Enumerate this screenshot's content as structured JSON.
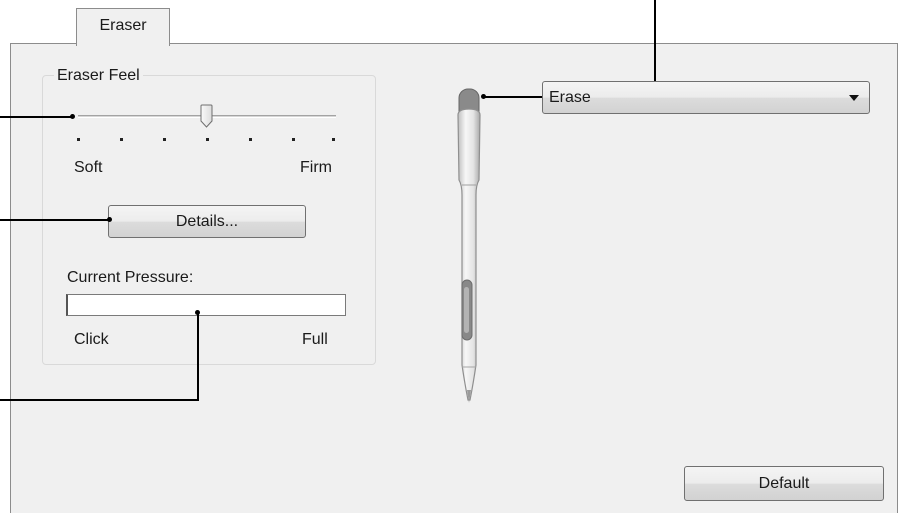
{
  "tabs": [
    {
      "label": "Eraser"
    }
  ],
  "eraser_feel": {
    "group_label": "Eraser Feel",
    "min_label": "Soft",
    "max_label": "Firm",
    "tick_count": 7,
    "value_fraction": 0.5,
    "details_button": "Details..."
  },
  "pressure": {
    "label": "Current Pressure:",
    "min_label": "Click",
    "max_label": "Full",
    "level_fraction": 0
  },
  "eraser_function": {
    "selected": "Erase"
  },
  "default_button": "Default"
}
